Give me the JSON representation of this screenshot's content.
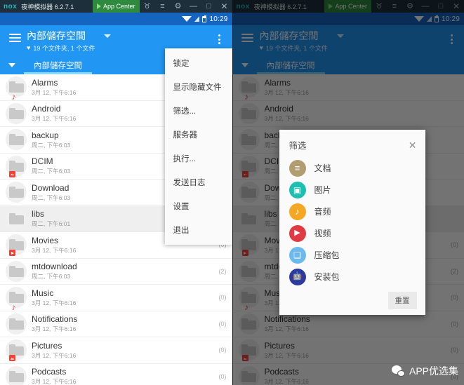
{
  "emulator": {
    "brand": "nox",
    "title": "夜神模拟器 6.2.7.1",
    "app_center": "App Center",
    "icons": [
      "shirt-icon",
      "menu-icon",
      "gear-icon",
      "minimize-icon",
      "maximize-icon",
      "close-icon"
    ],
    "minimize": "—",
    "maximize": "□",
    "close": "✕",
    "shirt": "♉",
    "menu": "≡",
    "gear": "⚙"
  },
  "statusbar": {
    "time": "10:29"
  },
  "appbar": {
    "title": "內部儲存空間",
    "subtitle": "19 个文件夹, 1 个文件",
    "heart": "♥",
    "breadcrumb": "內部儲存空間"
  },
  "overflow_menu": {
    "items": [
      {
        "label": "锁定"
      },
      {
        "label": "显示隐藏文件"
      },
      {
        "label": "筛选..."
      },
      {
        "label": "服务器"
      },
      {
        "label": "执行..."
      },
      {
        "label": "发送日志"
      },
      {
        "label": "设置"
      },
      {
        "label": "退出"
      }
    ]
  },
  "files": [
    {
      "name": "Alarms",
      "date": "3月 12, 下午6:16",
      "count": "",
      "badge": "music",
      "selected": false
    },
    {
      "name": "Android",
      "date": "3月 12, 下午6:16",
      "count": "",
      "badge": "",
      "selected": false
    },
    {
      "name": "backup",
      "date": "周二, 下午6:03",
      "count": "",
      "badge": "",
      "selected": false
    },
    {
      "name": "DCIM",
      "date": "周二, 下午6:03",
      "count": "",
      "badge": "image",
      "selected": false
    },
    {
      "name": "Download",
      "date": "周二, 下午6:03",
      "count": "",
      "badge": "",
      "selected": false
    },
    {
      "name": "libs",
      "date": "周二, 下午6:01",
      "count": "",
      "badge": "",
      "selected": true
    },
    {
      "name": "Movies",
      "date": "3月 12, 下午6:16",
      "count": "(0)",
      "badge": "video",
      "selected": false
    },
    {
      "name": "mtdownload",
      "date": "周二, 下午6:03",
      "count": "(2)",
      "badge": "",
      "selected": false
    },
    {
      "name": "Music",
      "date": "3月 12, 下午6:16",
      "count": "(0)",
      "badge": "music",
      "selected": false
    },
    {
      "name": "Notifications",
      "date": "3月 12, 下午6:16",
      "count": "(0)",
      "badge": "",
      "selected": false
    },
    {
      "name": "Pictures",
      "date": "3月 12, 下午6:16",
      "count": "(0)",
      "badge": "image",
      "selected": false
    },
    {
      "name": "Podcasts",
      "date": "3月 12, 下午6:16",
      "count": "(0)",
      "badge": "",
      "selected": false
    }
  ],
  "filter_dialog": {
    "title": "筛选",
    "close": "✕",
    "reset": "重置",
    "items": [
      {
        "label": "文档",
        "icon": "document-icon",
        "color": "#b29d72",
        "glyph": "ic-doc"
      },
      {
        "label": "图片",
        "icon": "image-icon",
        "color": "#1dbfb0",
        "glyph": "ic-img"
      },
      {
        "label": "音频",
        "icon": "audio-icon",
        "color": "#f5a623",
        "glyph": "ic-aud"
      },
      {
        "label": "视频",
        "icon": "video-icon",
        "color": "#e03b44",
        "glyph": "ic-vid"
      },
      {
        "label": "压缩包",
        "icon": "archive-icon",
        "color": "#6cb9ee",
        "glyph": "ic-zip"
      },
      {
        "label": "安装包",
        "icon": "package-icon",
        "color": "#2a3a9e",
        "glyph": "ic-apk"
      }
    ]
  },
  "watermark": {
    "label": "APP优选集"
  },
  "colors": {
    "accent": "#2196F3",
    "statusbar": "#1565C0",
    "titlebar": "#1d2f3a",
    "appcenter": "#2d8a3e"
  }
}
